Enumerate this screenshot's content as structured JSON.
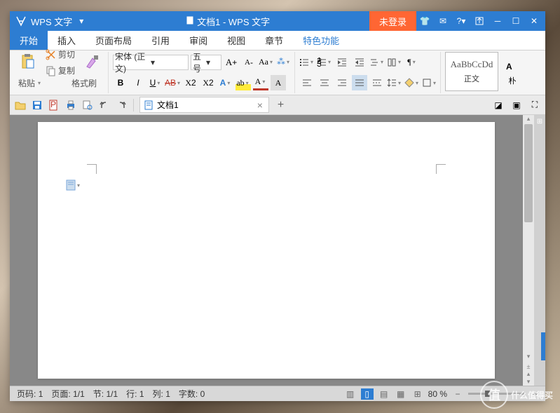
{
  "app": {
    "name": "WPS 文字",
    "doc_title": "文档1 - WPS 文字",
    "login_badge": "未登录"
  },
  "menus": {
    "start": "开始",
    "insert": "插入",
    "layout": "页面布局",
    "reference": "引用",
    "review": "审阅",
    "view": "视图",
    "chapter": "章节",
    "special": "特色功能"
  },
  "ribbon": {
    "cut": "剪切",
    "copy": "复制",
    "paste": "粘贴",
    "format_painter": "格式刷",
    "font_name": "宋体 (正文)",
    "font_size": "五号",
    "style_preview": "AaBbCcDd",
    "style_name": "正文"
  },
  "tabs": {
    "doc1": "文档1"
  },
  "status": {
    "page_num_lbl": "页码:",
    "page_num": "1",
    "page_lbl": "页面:",
    "page": "1/1",
    "section_lbl": "节:",
    "section": "1/1",
    "line_lbl": "行:",
    "line": "1",
    "col_lbl": "列:",
    "col": "1",
    "words_lbl": "字数:",
    "words": "0",
    "zoom": "80 %"
  },
  "watermark": {
    "circle": "值",
    "text": "什么值得买"
  }
}
